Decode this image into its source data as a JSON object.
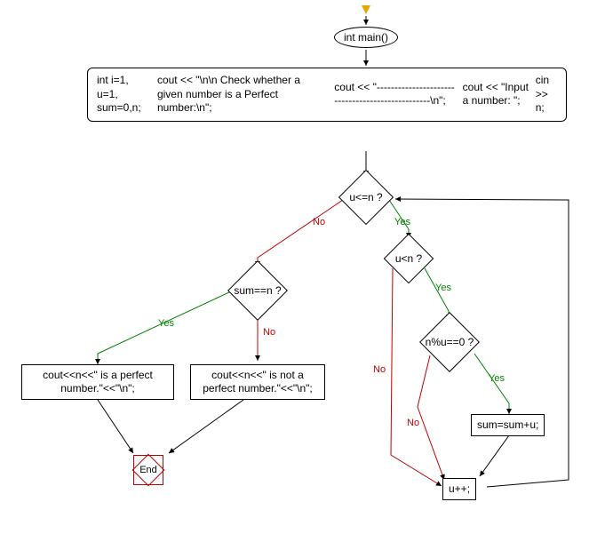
{
  "chart_data": {
    "type": "flowchart",
    "nodes": [
      {
        "id": "start",
        "kind": "start-arrow"
      },
      {
        "id": "main",
        "kind": "ellipse",
        "text": "int main()"
      },
      {
        "id": "init",
        "kind": "code",
        "lines": [
          "int i=1, u=1, sum=0,n;",
          "cout << \"\\n\\n Check whether a given number is a Perfect number:\\n\";",
          "cout << \"-------------------------------------------------\\n\";",
          "cout << \"Input a number: \";",
          "cin >> n;"
        ]
      },
      {
        "id": "d1",
        "kind": "decision",
        "text": "u<=n ?"
      },
      {
        "id": "d2",
        "kind": "decision",
        "text": "sum==n ?"
      },
      {
        "id": "d3",
        "kind": "decision",
        "text": "u<n ?"
      },
      {
        "id": "d4",
        "kind": "decision",
        "text": "n%u==0 ?"
      },
      {
        "id": "p_perfect",
        "kind": "process",
        "text": "cout<<n<<\" is a perfect number.\"<<\"\\n\";"
      },
      {
        "id": "p_notperfect",
        "kind": "process",
        "text": "cout<<n<<\" is not a perfect number.\"<<\"\\n\";"
      },
      {
        "id": "p_sum",
        "kind": "process",
        "text": "sum=sum+u;"
      },
      {
        "id": "p_inc",
        "kind": "process",
        "text": "u++;"
      },
      {
        "id": "end",
        "kind": "end",
        "text": "End"
      }
    ],
    "edges": [
      {
        "from": "start",
        "to": "main"
      },
      {
        "from": "main",
        "to": "init"
      },
      {
        "from": "init",
        "to": "d1"
      },
      {
        "from": "d1",
        "to": "d3",
        "label": "Yes"
      },
      {
        "from": "d1",
        "to": "d2",
        "label": "No"
      },
      {
        "from": "d3",
        "to": "d4",
        "label": "Yes"
      },
      {
        "from": "d3",
        "to": "p_inc",
        "label": "No"
      },
      {
        "from": "d4",
        "to": "p_sum",
        "label": "Yes"
      },
      {
        "from": "d4",
        "to": "p_inc",
        "label": "No"
      },
      {
        "from": "p_sum",
        "to": "p_inc"
      },
      {
        "from": "p_inc",
        "to": "d1"
      },
      {
        "from": "d2",
        "to": "p_perfect",
        "label": "Yes"
      },
      {
        "from": "d2",
        "to": "p_notperfect",
        "label": "No"
      },
      {
        "from": "p_perfect",
        "to": "end"
      },
      {
        "from": "p_notperfect",
        "to": "end"
      }
    ]
  },
  "labels": {
    "main": "int main()",
    "init_line1": "int i=1, u=1, sum=0,n;",
    "init_line2": "cout << \"\\n\\n Check whether a given number is a Perfect number:\\n\";",
    "init_line3": "cout << \"-------------------------------------------------\\n\";",
    "init_line4": "cout << \"Input a number: \";",
    "init_line5": "cin >> n;",
    "d1": "u<=n ?",
    "d2": "sum==n ?",
    "d3": "u<n ?",
    "d4": "n%u==0 ?",
    "p_perfect": "cout<<n<<\" is a perfect\nnumber.\"<<\"\\n\";",
    "p_notperfect": "cout<<n<<\" is not a\nperfect number.\"<<\"\\n\";",
    "p_sum": "sum=sum+u;",
    "p_inc": "u++;",
    "end": "End",
    "yes": "Yes",
    "no": "No"
  }
}
